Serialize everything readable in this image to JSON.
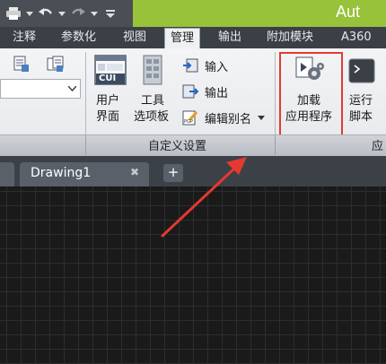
{
  "window": {
    "title": "Aut"
  },
  "ribbon_tabs": [
    {
      "label": "注释"
    },
    {
      "label": "参数化"
    },
    {
      "label": "视图"
    },
    {
      "label": "管理"
    },
    {
      "label": "输出"
    },
    {
      "label": "附加模块"
    },
    {
      "label": "A360"
    }
  ],
  "active_tab": "管理",
  "customization_panel": {
    "title": "自定义设置",
    "user_interface": {
      "line1": "用户",
      "line2": "界面",
      "badge": "CUI"
    },
    "tool_palettes": {
      "line1": "工具",
      "line2": "选项板"
    },
    "import_label": "输入",
    "export_label": "输出",
    "edit_aliases_label": "编辑别名"
  },
  "applications_panel": {
    "title_partial": "应",
    "load_application": {
      "line1": "加载",
      "line2": "应用程序"
    },
    "run_script": {
      "line1": "运行",
      "line2": "脚本"
    }
  },
  "file_tabs": {
    "active": "Drawing1",
    "close_glyph": "✖",
    "add_glyph": "+"
  },
  "colors": {
    "title_green": "#97c23a",
    "highlight_red": "#e03c33",
    "canvas_bg": "#1a1a1a"
  }
}
